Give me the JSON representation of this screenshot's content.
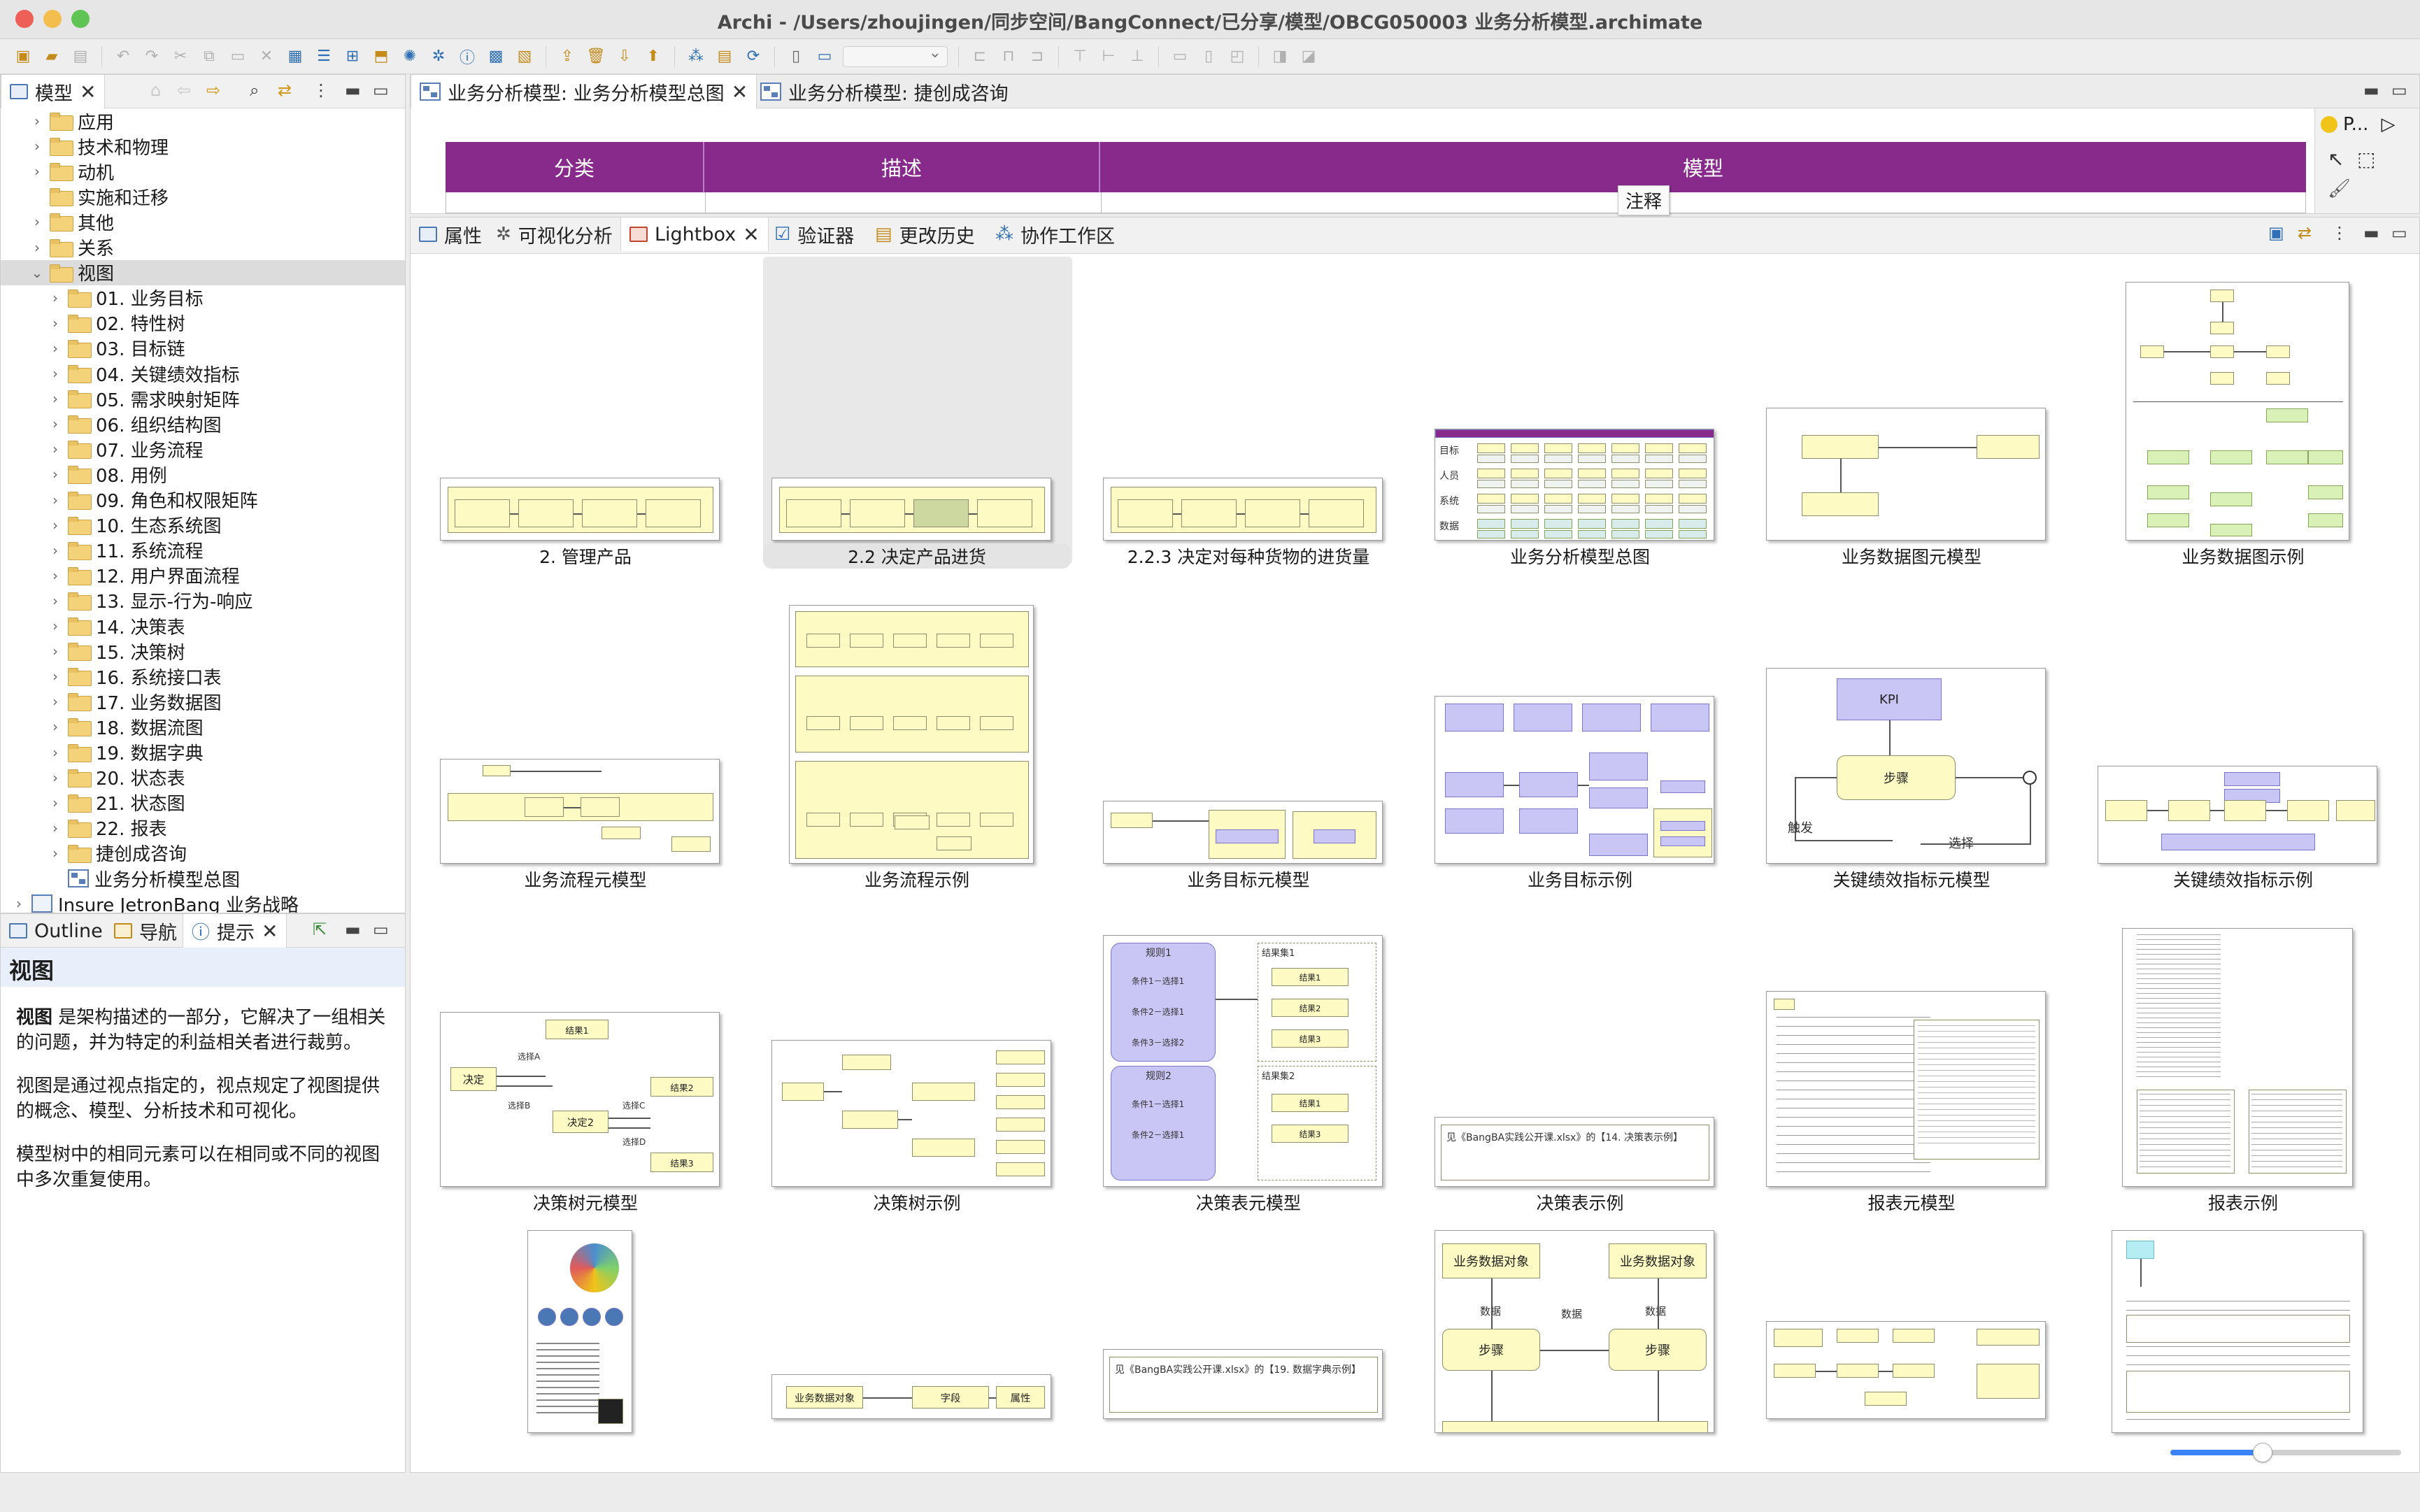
{
  "window": {
    "title": "Archi - /Users/zhoujingen/同步空间/BangConnect/已分享/模型/OBCG050003 业务分析模型.archimate"
  },
  "colors": {
    "band": "#882a8c",
    "yellow": "#fdfbc3",
    "purple": "#c9c5f5",
    "green": "#d9f0b7"
  },
  "model_tree": {
    "tab_label": "模型",
    "items": [
      {
        "label": "应用",
        "indent": 1,
        "expand": "›",
        "icon": "folder"
      },
      {
        "label": "技术和物理",
        "indent": 1,
        "expand": "›",
        "icon": "folder"
      },
      {
        "label": "动机",
        "indent": 1,
        "expand": "›",
        "icon": "folder"
      },
      {
        "label": "实施和迁移",
        "indent": 1,
        "expand": "",
        "icon": "folder"
      },
      {
        "label": "其他",
        "indent": 1,
        "expand": "›",
        "icon": "folder"
      },
      {
        "label": "关系",
        "indent": 1,
        "expand": "›",
        "icon": "folder"
      },
      {
        "label": "视图",
        "indent": 1,
        "expand": "⌄",
        "icon": "folder",
        "selected": true
      },
      {
        "label": "01. 业务目标",
        "indent": 2,
        "expand": "›",
        "icon": "folder"
      },
      {
        "label": "02. 特性树",
        "indent": 2,
        "expand": "›",
        "icon": "folder"
      },
      {
        "label": "03. 目标链",
        "indent": 2,
        "expand": "›",
        "icon": "folder"
      },
      {
        "label": "04. 关键绩效指标",
        "indent": 2,
        "expand": "›",
        "icon": "folder"
      },
      {
        "label": "05. 需求映射矩阵",
        "indent": 2,
        "expand": "›",
        "icon": "folder"
      },
      {
        "label": "06. 组织结构图",
        "indent": 2,
        "expand": "›",
        "icon": "folder"
      },
      {
        "label": "07. 业务流程",
        "indent": 2,
        "expand": "›",
        "icon": "folder"
      },
      {
        "label": "08. 用例",
        "indent": 2,
        "expand": "›",
        "icon": "folder"
      },
      {
        "label": "09. 角色和权限矩阵",
        "indent": 2,
        "expand": "›",
        "icon": "folder"
      },
      {
        "label": "10. 生态系统图",
        "indent": 2,
        "expand": "›",
        "icon": "folder"
      },
      {
        "label": "11. 系统流程",
        "indent": 2,
        "expand": "›",
        "icon": "folder"
      },
      {
        "label": "12. 用户界面流程",
        "indent": 2,
        "expand": "›",
        "icon": "folder"
      },
      {
        "label": "13. 显示-行为-响应",
        "indent": 2,
        "expand": "›",
        "icon": "folder"
      },
      {
        "label": "14. 决策表",
        "indent": 2,
        "expand": "›",
        "icon": "folder"
      },
      {
        "label": "15. 决策树",
        "indent": 2,
        "expand": "›",
        "icon": "folder"
      },
      {
        "label": "16. 系统接口表",
        "indent": 2,
        "expand": "›",
        "icon": "folder"
      },
      {
        "label": "17. 业务数据图",
        "indent": 2,
        "expand": "›",
        "icon": "folder"
      },
      {
        "label": "18. 数据流图",
        "indent": 2,
        "expand": "›",
        "icon": "folder"
      },
      {
        "label": "19. 数据字典",
        "indent": 2,
        "expand": "›",
        "icon": "folder"
      },
      {
        "label": "20. 状态表",
        "indent": 2,
        "expand": "›",
        "icon": "folder"
      },
      {
        "label": "21. 状态图",
        "indent": 2,
        "expand": "›",
        "icon": "folder"
      },
      {
        "label": "22. 报表",
        "indent": 2,
        "expand": "›",
        "icon": "folder"
      },
      {
        "label": "捷创成咨询",
        "indent": 2,
        "expand": "›",
        "icon": "folder"
      },
      {
        "label": "业务分析模型总图",
        "indent": 2,
        "expand": "",
        "icon": "view"
      },
      {
        "label": "Insure JetronBang 业务战略",
        "indent": 0,
        "expand": "›",
        "icon": "model"
      }
    ]
  },
  "lower_left": {
    "tabs": [
      "Outline",
      "导航",
      "提示"
    ],
    "help": {
      "heading": "视图",
      "p1_bold": "视图",
      "p1_rest": " 是架构描述的一部分，它解决了一组相关的问题，并为特定的利益相关者进行裁剪。",
      "p2": "视图是通过视点指定的，视点规定了视图提供的概念、模型、分析技术和可视化。",
      "p3": "模型树中的相同元素可以在相同或不同的视图中多次重复使用。"
    }
  },
  "editor": {
    "tabs": [
      "业务分析模型: 业务分析模型总图",
      "业务分析模型: 捷创成咨询"
    ],
    "band": [
      "分类",
      "描述",
      "模型"
    ],
    "tooltip": "注释",
    "palette_label": "P..."
  },
  "bottom_panel": {
    "tabs": [
      "属性",
      "可视化分析",
      "Lightbox",
      "验证器",
      "更改历史",
      "协作工作区"
    ]
  },
  "thumbnails": [
    {
      "caption": "2. 管理产品",
      "col": 0,
      "row": 0,
      "kind": "chain"
    },
    {
      "caption": "2.2 决定产品进货",
      "col": 1,
      "row": 0,
      "kind": "chain",
      "selected": true
    },
    {
      "caption": "2.2.3 决定对每种货物的进货量",
      "col": 2,
      "row": 0,
      "kind": "chain"
    },
    {
      "caption": "业务分析模型总图",
      "col": 3,
      "row": 0,
      "kind": "overview"
    },
    {
      "caption": "业务数据图元模型",
      "col": 4,
      "row": 0,
      "kind": "datameta"
    },
    {
      "caption": "业务数据图示例",
      "col": 5,
      "row": 0,
      "kind": "datatree"
    },
    {
      "caption": "业务流程元模型",
      "col": 0,
      "row": 1,
      "kind": "process"
    },
    {
      "caption": "业务流程示例",
      "col": 1,
      "row": 1,
      "kind": "lanes"
    },
    {
      "caption": "业务目标元模型",
      "col": 2,
      "row": 1,
      "kind": "goalmeta"
    },
    {
      "caption": "业务目标示例",
      "col": 3,
      "row": 1,
      "kind": "goals"
    },
    {
      "caption": "关键绩效指标元模型",
      "col": 4,
      "row": 1,
      "kind": "kpi"
    },
    {
      "caption": "关键绩效指标示例",
      "col": 5,
      "row": 1,
      "kind": "kpiex"
    },
    {
      "caption": "决策树元模型",
      "col": 0,
      "row": 2,
      "kind": "tree"
    },
    {
      "caption": "决策树示例",
      "col": 1,
      "row": 2,
      "kind": "tree2"
    },
    {
      "caption": "决策表元模型",
      "col": 2,
      "row": 2,
      "kind": "dtable"
    },
    {
      "caption": "决策表示例",
      "col": 3,
      "row": 2,
      "kind": "note"
    },
    {
      "caption": "报表元模型",
      "col": 4,
      "row": 2,
      "kind": "report"
    },
    {
      "caption": "报表示例",
      "col": 5,
      "row": 2,
      "kind": "reportex"
    },
    {
      "caption": "",
      "col": 0,
      "row": 3,
      "kind": "poster"
    },
    {
      "caption": "",
      "col": 1,
      "row": 3,
      "kind": "entity"
    },
    {
      "caption": "",
      "col": 2,
      "row": 3,
      "kind": "note2"
    },
    {
      "caption": "",
      "col": 3,
      "row": 3,
      "kind": "dataflow"
    },
    {
      "caption": "",
      "col": 4,
      "row": 3,
      "kind": "small"
    },
    {
      "caption": "",
      "col": 5,
      "row": 3,
      "kind": "doc"
    }
  ],
  "thumb_text": {
    "kpi": "KPI",
    "step": "步骤",
    "trigger": "触发",
    "choose": "选择",
    "node1": "规则1",
    "node2": "规则2",
    "set1": "结果集1",
    "set2": "结果集2",
    "cond": [
      "条件1－选择1",
      "条件2－选择1",
      "条件3－选择2"
    ],
    "cond2": [
      "条件1－选择1",
      "条件2－选择1"
    ],
    "res": [
      "结果1",
      "结果2",
      "结果3"
    ],
    "res2": [
      "结果1",
      "结果3"
    ],
    "decide": "决定",
    "decide2": "决定2",
    "choices": [
      "选择A",
      "选择B",
      "选择C",
      "选择D"
    ],
    "note": "见《BangBA实践公开课.xlsx》的【14. 决策表示例】",
    "note2": "见《BangBA实践公开课.xlsx》的【19. 数据字典示例】",
    "dataobj": "业务数据对象",
    "data": "数据",
    "overview_rows": [
      "目标",
      "人员",
      "系统",
      "数据"
    ],
    "entity": [
      "业务数据对象",
      "字段",
      "属性"
    ]
  }
}
